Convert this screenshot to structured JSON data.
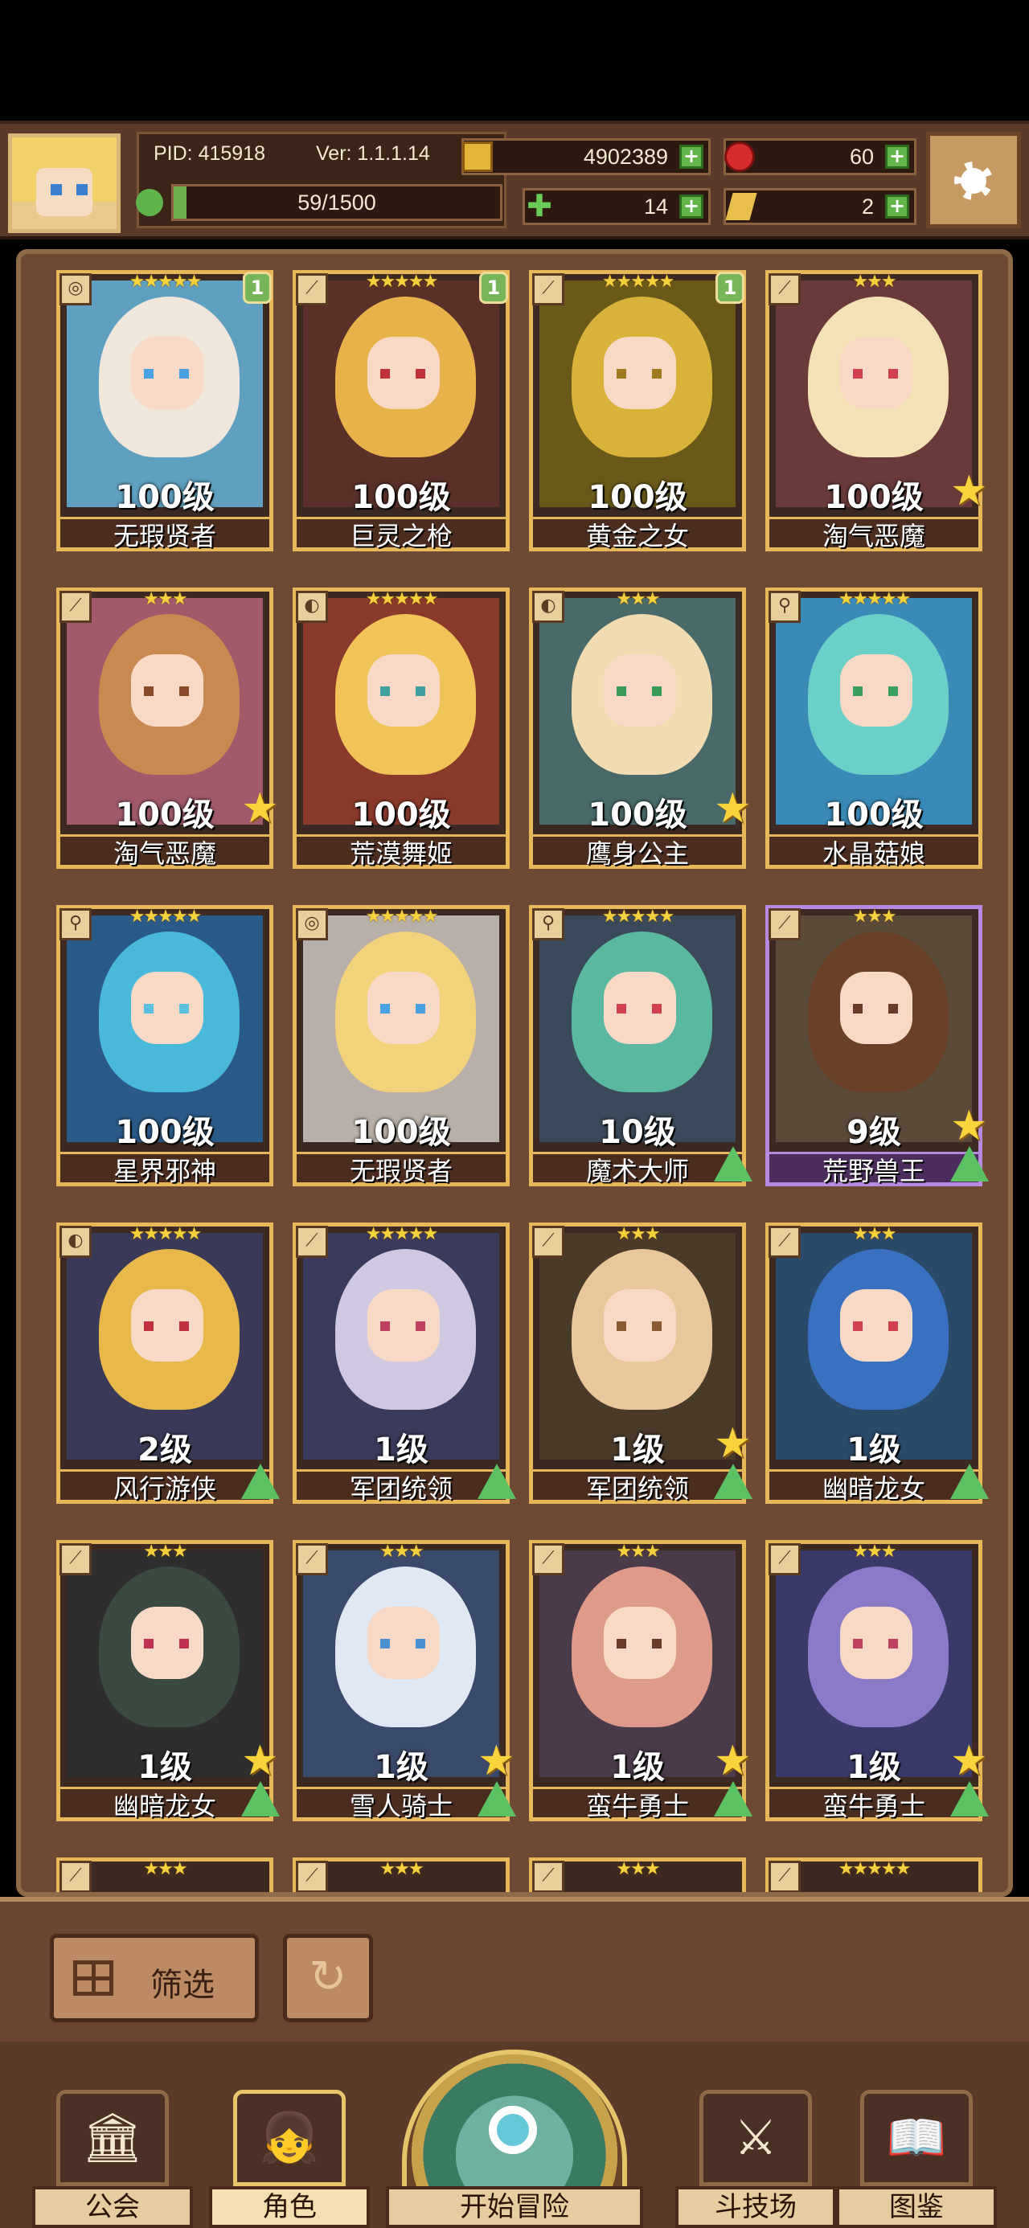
{
  "header": {
    "pid": "PID: 415918",
    "version": "Ver: 1.1.1.14",
    "gold": "4902389",
    "ruby": "60",
    "stamina": "59/1500",
    "clover": "14",
    "key": "2",
    "stamina_fill": 0.039
  },
  "cards": [
    {
      "stars": "★★★★★",
      "level": "100级",
      "name": "无瑕贤者",
      "badge": "1",
      "weapon": "staff",
      "hair": "#efe6dc",
      "bg": "#5fa0c0",
      "eye": "#4aa0e0",
      "star_up": false,
      "arrow_up": false,
      "purple": false
    },
    {
      "stars": "★★★★★",
      "level": "100级",
      "name": "巨灵之枪",
      "badge": "1",
      "weapon": "spear",
      "hair": "#e7b24a",
      "bg": "#5a3028",
      "eye": "#c0303a",
      "star_up": false,
      "arrow_up": false,
      "purple": false
    },
    {
      "stars": "★★★★★",
      "level": "100级",
      "name": "黄金之女",
      "badge": "1",
      "weapon": "spear",
      "hair": "#d9b23a",
      "bg": "#6a5a1a",
      "eye": "#a07a20",
      "star_up": false,
      "arrow_up": false,
      "purple": false
    },
    {
      "stars": "★★★",
      "level": "100级",
      "name": "淘气恶魔",
      "badge": "",
      "weapon": "spear",
      "hair": "#f2e2b5",
      "bg": "#6a3a3a",
      "eye": "#d04050",
      "star_up": true,
      "arrow_up": false,
      "purple": false
    },
    {
      "stars": "★★★",
      "level": "100级",
      "name": "淘气恶魔",
      "badge": "",
      "weapon": "spear",
      "hair": "#c98a52",
      "bg": "#a05a6a",
      "eye": "#8a4a2a",
      "star_up": true,
      "arrow_up": false,
      "purple": false
    },
    {
      "stars": "★★★★★",
      "level": "100级",
      "name": "荒漠舞姬",
      "badge": "",
      "weapon": "bow",
      "hair": "#f1c45a",
      "bg": "#8a3a2a",
      "eye": "#40a0a0",
      "star_up": false,
      "arrow_up": false,
      "purple": false
    },
    {
      "stars": "★★★",
      "level": "100级",
      "name": "鹰身公主",
      "badge": "",
      "weapon": "bow",
      "hair": "#f0dcb0",
      "bg": "#4a6a6a",
      "eye": "#3a9a5a",
      "star_up": true,
      "arrow_up": false,
      "purple": false
    },
    {
      "stars": "★★★★★",
      "level": "100级",
      "name": "水晶菇娘",
      "badge": "",
      "weapon": "wand",
      "hair": "#6ad0c8",
      "bg": "#3a8ab8",
      "eye": "#3aa060",
      "star_up": false,
      "arrow_up": false,
      "purple": false
    },
    {
      "stars": "★★★★★",
      "level": "100级",
      "name": "星界邪神",
      "badge": "",
      "weapon": "wand",
      "hair": "#4ab8d8",
      "bg": "#2a5a88",
      "eye": "#5ac0e0",
      "star_up": false,
      "arrow_up": false,
      "purple": false
    },
    {
      "stars": "★★★★★",
      "level": "100级",
      "name": "无瑕贤者",
      "badge": "",
      "weapon": "staff",
      "hair": "#f2d27a",
      "bg": "#b8b0a8",
      "eye": "#4aa0e0",
      "star_up": false,
      "arrow_up": false,
      "purple": false
    },
    {
      "stars": "★★★★★",
      "level": "10级",
      "name": "魔术大师",
      "badge": "",
      "weapon": "wand",
      "hair": "#5ab8a0",
      "bg": "#3a4a5a",
      "eye": "#d04050",
      "star_up": false,
      "arrow_up": true,
      "purple": false
    },
    {
      "stars": "★★★",
      "level": "9级",
      "name": "荒野兽王",
      "badge": "",
      "weapon": "spear",
      "hair": "#6a4028",
      "bg": "#5a4a3a",
      "eye": "#6a3a2a",
      "star_up": true,
      "arrow_up": true,
      "purple": true
    },
    {
      "stars": "★★★★★",
      "level": "2级",
      "name": "风行游侠",
      "badge": "",
      "weapon": "bow",
      "hair": "#e9b84a",
      "bg": "#3a3a58",
      "eye": "#c03040",
      "star_up": false,
      "arrow_up": true,
      "purple": false
    },
    {
      "stars": "★★★★★",
      "level": "1级",
      "name": "军团统领",
      "badge": "",
      "weapon": "spear",
      "hair": "#cfc8e0",
      "bg": "#3a3a5a",
      "eye": "#c04060",
      "star_up": false,
      "arrow_up": true,
      "purple": false
    },
    {
      "stars": "★★★",
      "level": "1级",
      "name": "军团统领",
      "badge": "",
      "weapon": "spear",
      "hair": "#e8c89a",
      "bg": "#4a3a2a",
      "eye": "#8a5a30",
      "star_up": true,
      "arrow_up": true,
      "purple": false
    },
    {
      "stars": "★★★",
      "level": "1级",
      "name": "幽暗龙女",
      "badge": "",
      "weapon": "spear",
      "hair": "#3a70c0",
      "bg": "#2a4a6a",
      "eye": "#d04050",
      "star_up": false,
      "arrow_up": true,
      "purple": false
    },
    {
      "stars": "★★★",
      "level": "1级",
      "name": "幽暗龙女",
      "badge": "",
      "weapon": "spear",
      "hair": "#3a4a40",
      "bg": "#2e2e2e",
      "eye": "#c03050",
      "star_up": true,
      "arrow_up": true,
      "purple": false
    },
    {
      "stars": "★★★",
      "level": "1级",
      "name": "雪人骑士",
      "badge": "",
      "weapon": "spear",
      "hair": "#e0e8f4",
      "bg": "#3a4a6a",
      "eye": "#4a90d0",
      "star_up": true,
      "arrow_up": true,
      "purple": false
    },
    {
      "stars": "★★★",
      "level": "1级",
      "name": "蛮牛勇士",
      "badge": "",
      "weapon": "spear",
      "hair": "#e09a8a",
      "bg": "#4a3a4a",
      "eye": "#6a3a2a",
      "star_up": true,
      "arrow_up": true,
      "purple": false
    },
    {
      "stars": "★★★",
      "level": "1级",
      "name": "蛮牛勇士",
      "badge": "",
      "weapon": "spear",
      "hair": "#8a7ac8",
      "bg": "#3a3a6a",
      "eye": "#c04060",
      "star_up": true,
      "arrow_up": true,
      "purple": false
    }
  ],
  "partial_row_stars": [
    "★★★",
    "★★★",
    "★★★",
    "★★★★★"
  ],
  "controls": {
    "filter_label": "筛选"
  },
  "nav": {
    "guild": "公会",
    "roles": "角色",
    "adventure": "开始冒险",
    "arena": "斗技场",
    "codex": "图鉴"
  }
}
